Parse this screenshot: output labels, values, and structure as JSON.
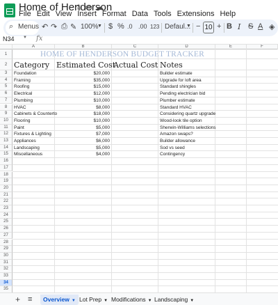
{
  "app": {
    "doc_title": "Home of Henderson",
    "menus": [
      "File",
      "Edit",
      "View",
      "Insert",
      "Format",
      "Data",
      "Tools",
      "Extensions",
      "Help"
    ]
  },
  "toolbar": {
    "menus_label": "Menus",
    "zoom": "100%",
    "currency": "$",
    "percent": "%",
    "dec_less": ".0",
    "dec_more": ".00",
    "number_format": "123",
    "font": "Defaul...",
    "font_size": "10",
    "bold": "B",
    "italic": "I",
    "strike": "S",
    "text_color": "A"
  },
  "formula_bar": {
    "name_box": "N34",
    "fx": "fx",
    "value": ""
  },
  "columns": [
    "A",
    "B",
    "C",
    "D",
    "E",
    "F"
  ],
  "rows": [
    "1",
    "2",
    "3",
    "4",
    "5",
    "6",
    "7",
    "8",
    "9",
    "10",
    "11",
    "12",
    "13",
    "14",
    "15",
    "16",
    "17",
    "18",
    "19",
    "20",
    "21",
    "22",
    "23",
    "24",
    "25",
    "26",
    "27",
    "28",
    "29",
    "30",
    "31",
    "32",
    "33",
    "34",
    "35",
    "36"
  ],
  "active_row": "34",
  "sheet": {
    "title": "HOME OF HENDERSON BUDGET TRACKER",
    "headers": {
      "category": "Category",
      "estimated": "Estimated Cost",
      "actual": "Actual Cost",
      "notes": "Notes"
    },
    "items": [
      {
        "category": "Foundation",
        "estimated": "$20,000",
        "notes": "Builder estimate"
      },
      {
        "category": "Framing",
        "estimated": "$35,000",
        "notes": "Upgrade for loft area"
      },
      {
        "category": "Roofing",
        "estimated": "$15,000",
        "notes": "Standard shingles"
      },
      {
        "category": "Electrical",
        "estimated": "$12,000",
        "notes": "Pending electrician bid"
      },
      {
        "category": "Plumbing",
        "estimated": "$10,000",
        "notes": "Plumber estimate"
      },
      {
        "category": "HVAC",
        "estimated": "$8,000",
        "notes": "Standard HVAC"
      },
      {
        "category": "Cabinets & Counterto",
        "estimated": "$18,000",
        "notes": "Considering quartz upgrade"
      },
      {
        "category": "Flooring",
        "estimated": "$10,000",
        "notes": "Wood-look tile option"
      },
      {
        "category": "Paint",
        "estimated": "$5,000",
        "notes": "Sherwin-Williams selections"
      },
      {
        "category": "Fixtures & Lighting",
        "estimated": "$7,000",
        "notes": "Amazon swaps?"
      },
      {
        "category": "Appliances",
        "estimated": "$6,000",
        "notes": "Builder allowance"
      },
      {
        "category": "Landscaping",
        "estimated": "$5,000",
        "notes": "Sod vs seed"
      },
      {
        "category": "Miscellaneous",
        "estimated": "$4,000",
        "notes": "Contingency"
      }
    ]
  },
  "tabs": [
    {
      "label": "Overview",
      "active": true
    },
    {
      "label": "Lot Prep",
      "active": false
    },
    {
      "label": "Modifications",
      "active": false
    },
    {
      "label": "Landscaping",
      "active": false
    }
  ]
}
